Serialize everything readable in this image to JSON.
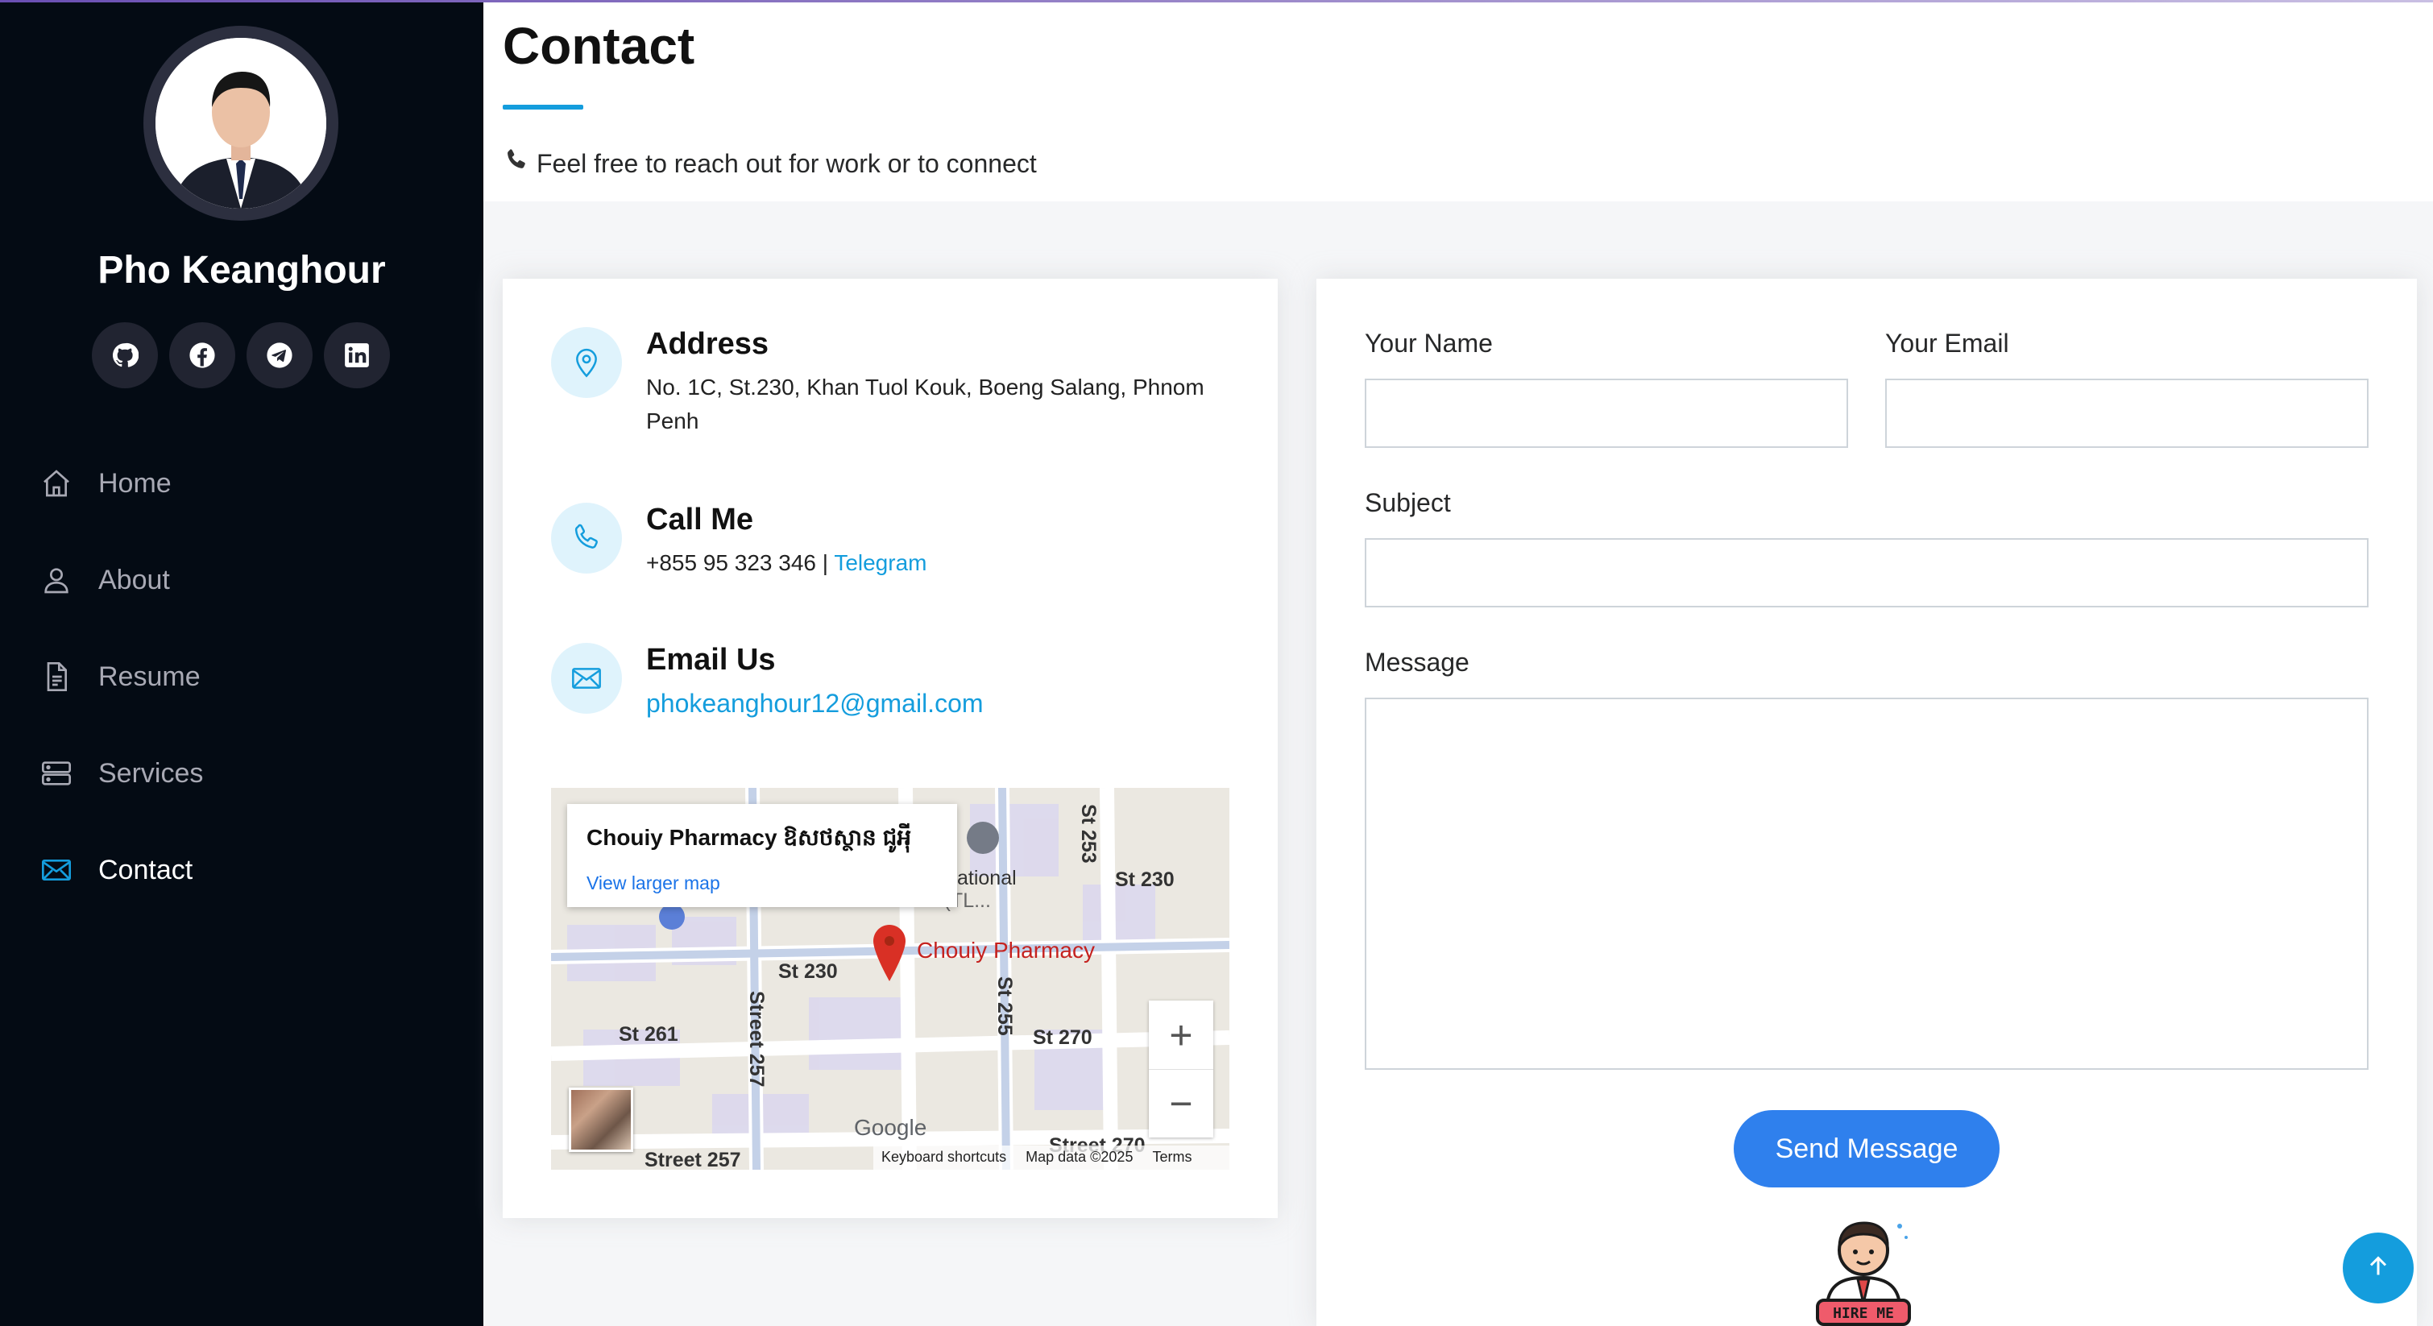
{
  "profile": {
    "name": "Pho Keanghour",
    "social": [
      {
        "icon": "github-icon"
      },
      {
        "icon": "facebook-icon"
      },
      {
        "icon": "telegram-icon"
      },
      {
        "icon": "linkedin-icon"
      }
    ]
  },
  "nav": {
    "items": [
      {
        "label": "Home",
        "icon": "home-icon"
      },
      {
        "label": "About",
        "icon": "person-icon"
      },
      {
        "label": "Resume",
        "icon": "file-icon"
      },
      {
        "label": "Services",
        "icon": "server-icon"
      },
      {
        "label": "Contact",
        "icon": "envelope-icon",
        "active": true
      }
    ]
  },
  "page": {
    "title": "Contact",
    "subtitle": "Feel free to reach out for work or to connect"
  },
  "contact": {
    "address": {
      "title": "Address",
      "text": "No. 1C, St.230, Khan Tuol Kouk, Boeng Salang, Phnom Penh"
    },
    "call": {
      "title": "Call Me",
      "phone": "+855 95 323 346",
      "separator": " | ",
      "telegram": "Telegram"
    },
    "email": {
      "title": "Email Us",
      "address": "phokeanghour12@gmail.com"
    }
  },
  "map": {
    "place_name": "Chouiy Pharmacy ឱសថស្ថាន ជូអុី",
    "view_larger": "View larger map",
    "marker_label": "Chouiy Pharmacy",
    "streets": [
      "St 230",
      "St 230",
      "St 253",
      "St 261",
      "Street 257",
      "St 255",
      "St 270",
      "Street 257",
      "Street 270",
      "ational",
      "chool Cambodia (TL..."
    ],
    "footer": {
      "shortcuts": "Keyboard shortcuts",
      "data": "Map data ©2025",
      "terms": "Terms"
    },
    "logo": "Google",
    "zoom_in": "+",
    "zoom_out": "−"
  },
  "form": {
    "name_label": "Your Name",
    "email_label": "Your Email",
    "subject_label": "Subject",
    "message_label": "Message",
    "send_label": "Send Message",
    "hire_badge": "HIRE ME"
  },
  "colors": {
    "accent": "#149ddd",
    "sidebar_bg": "#040b14",
    "button": "#2f80ed"
  }
}
